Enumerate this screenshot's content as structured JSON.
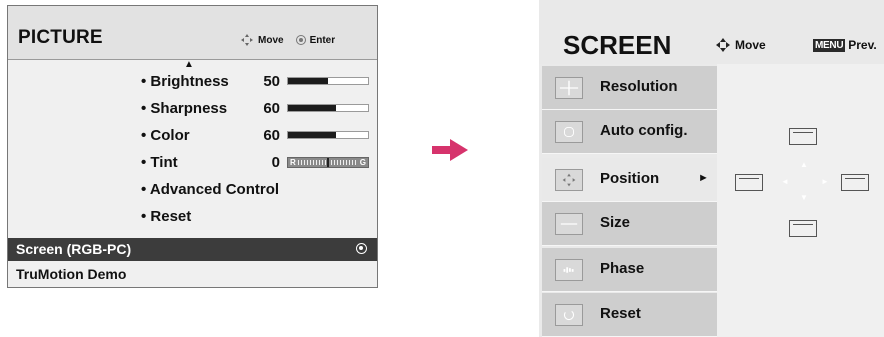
{
  "picture_menu": {
    "title": "PICTURE",
    "hint_move": "Move",
    "hint_enter": "Enter",
    "items": [
      {
        "label": "• Brightness",
        "value": "50",
        "level": 0.5
      },
      {
        "label": "• Sharpness",
        "value": "60",
        "level": 0.6
      },
      {
        "label": "• Color",
        "value": "60",
        "level": 0.6
      },
      {
        "label": "• Tint",
        "value": "0",
        "bar_left": "R",
        "bar_right": "G"
      },
      {
        "label": "• Advanced Control"
      },
      {
        "label": "• Reset"
      }
    ],
    "selected_item": "Screen (RGB-PC)",
    "bottom_item": "TruMotion Demo"
  },
  "screen_menu": {
    "title": "SCREEN",
    "hint_move": "Move",
    "menu_key": "MENU",
    "hint_prev": "Prev.",
    "items": [
      {
        "label": "Resolution",
        "icon": "resolution-icon"
      },
      {
        "label": "Auto config.",
        "icon": "auto-config-icon"
      },
      {
        "label": "Position",
        "icon": "position-icon"
      },
      {
        "label": "Size",
        "icon": "size-icon"
      },
      {
        "label": "Phase",
        "icon": "phase-icon"
      },
      {
        "label": "Reset",
        "icon": "reset-icon"
      }
    ],
    "active_item": "Position"
  },
  "colors": {
    "accent_arrow": "#d6336c",
    "selected_row": "#3c3c3c",
    "menu_item": "#cecece"
  }
}
